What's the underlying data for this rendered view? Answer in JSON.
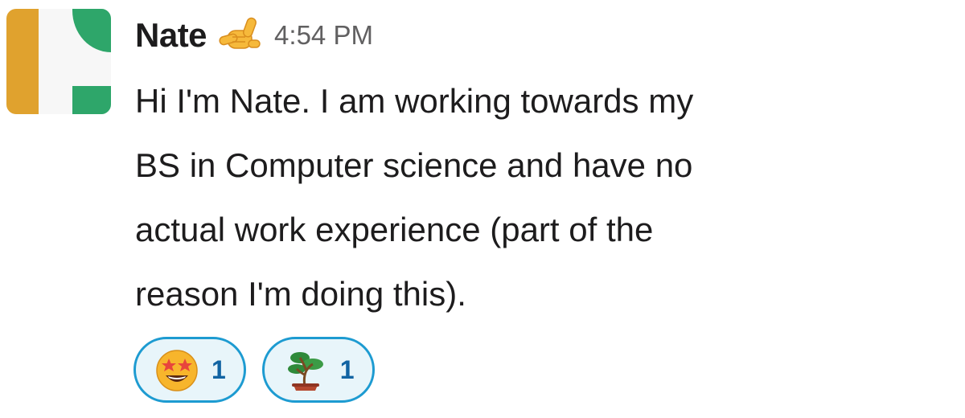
{
  "message": {
    "author": "Nate",
    "status_emoji": "call-me-hand-emoji",
    "timestamp": "4:54 PM",
    "body_lines": [
      "Hi I'm Nate. I am working towards my",
      "BS in Computer science and have no",
      "actual work experience (part of the",
      "reason I'm doing this)."
    ],
    "reactions": [
      {
        "emoji": "star-struck-emoji",
        "count": "1"
      },
      {
        "emoji": "bonsai-tree-emoji",
        "count": "1"
      }
    ]
  },
  "colors": {
    "reaction_border": "#1d9bd1",
    "reaction_bg": "#e8f5fa",
    "reaction_count": "#1264a3",
    "avatar_orange": "#e0a22e",
    "avatar_green": "#2ea66a"
  }
}
